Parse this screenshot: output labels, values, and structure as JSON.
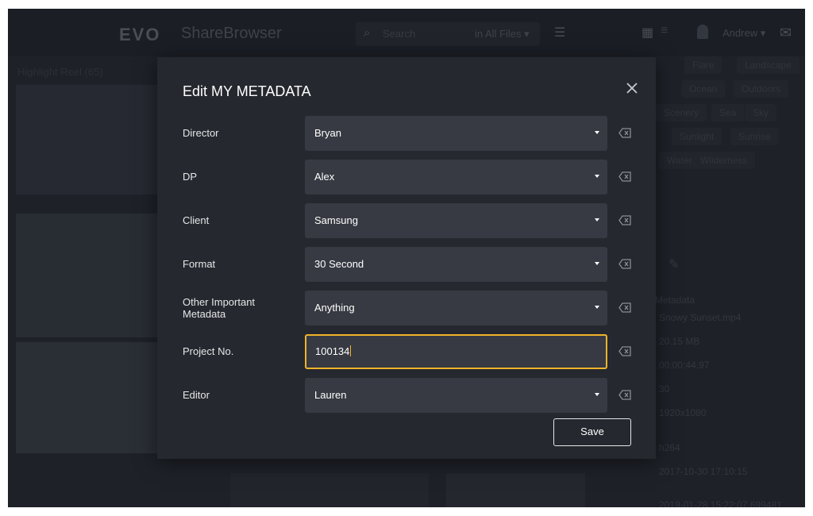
{
  "background": {
    "logo": "EVO",
    "app_name": "ShareBrowser",
    "search_placeholder": "Search",
    "search_scope": "in All Files ▾",
    "user_name": "Andrew ▾",
    "reel_title": "Highlight Reel (65)",
    "tags": [
      "Flare",
      "Landscape",
      "Ocean",
      "Outdoors",
      "Scenery",
      "Sea",
      "Sky",
      "Sunlight",
      "Sunrise",
      "Water",
      "Wilderness"
    ],
    "metadata_label": "Metadata",
    "metadata_values": [
      "Snowy Sunset.mp4",
      "20.15 MB",
      "00:00:44.97",
      "30",
      "1920x1080",
      "h264",
      "2017-10-30 17:10:15",
      "2019-01-28 15:22:07.699481"
    ]
  },
  "modal": {
    "title": "Edit MY METADATA",
    "fields": [
      {
        "label": "Director",
        "value": "Bryan"
      },
      {
        "label": "DP",
        "value": "Alex"
      },
      {
        "label": "Client",
        "value": "Samsung"
      },
      {
        "label": "Format",
        "value": "30 Second"
      },
      {
        "label": "Other Important Metadata",
        "value": "Anything"
      },
      {
        "label": "Project No.",
        "value": "100134"
      },
      {
        "label": "Editor",
        "value": "Lauren"
      }
    ],
    "save_label": "Save"
  },
  "colors": {
    "accent_focus": "#f0b429",
    "modal_bg": "#25282e",
    "field_bg": "#373a42"
  }
}
